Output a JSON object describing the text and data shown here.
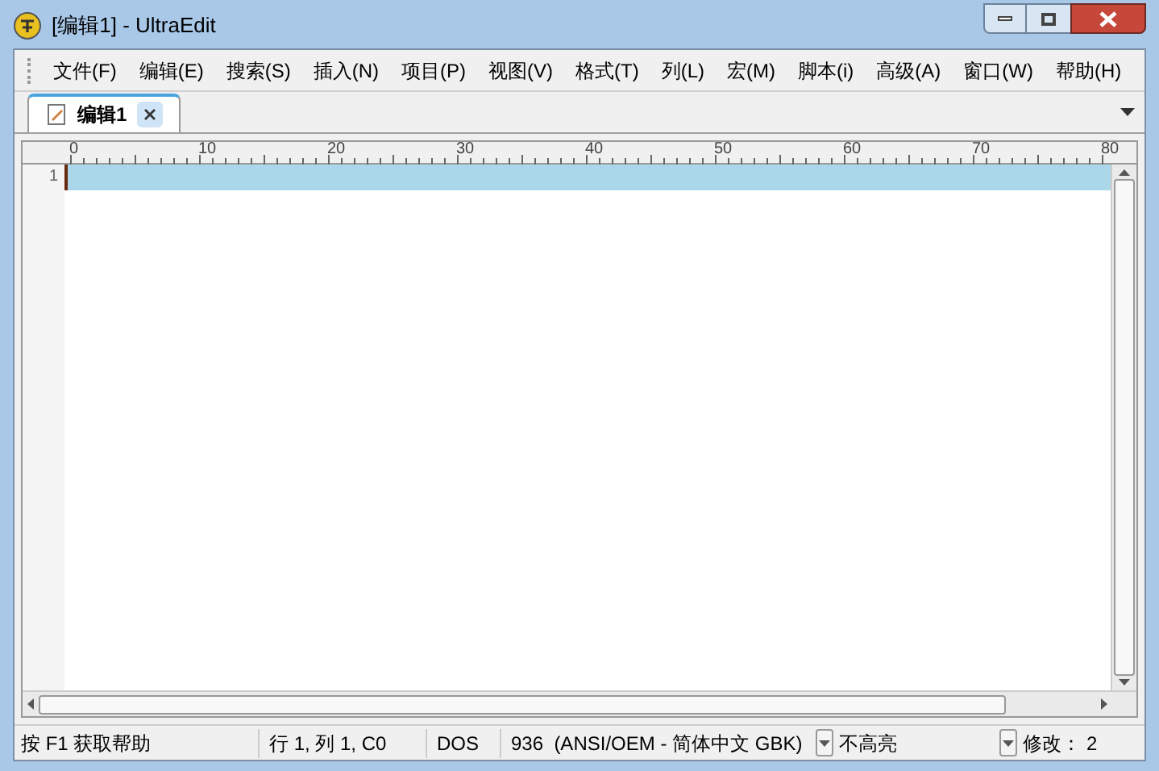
{
  "window": {
    "title": "[编辑1] - UltraEdit"
  },
  "menu": [
    "文件(F)",
    "编辑(E)",
    "搜索(S)",
    "插入(N)",
    "项目(P)",
    "视图(V)",
    "格式(T)",
    "列(L)",
    "宏(M)",
    "脚本(i)",
    "高级(A)",
    "窗口(W)",
    "帮助(H)"
  ],
  "tabs": [
    {
      "label": "编辑1",
      "selected": true
    }
  ],
  "ruler": [
    "0",
    "10",
    "20",
    "30",
    "40",
    "50",
    "60",
    "70",
    "80"
  ],
  "editor": {
    "line_numbers": [
      "1"
    ]
  },
  "status_bar": {
    "help": "按 F1 获取帮助",
    "position": "行 1, 列 1, C0",
    "line_ending": "DOS",
    "encoding": "936  (ANSI/OEM - 简体中文 GBK)",
    "highlight": "不高亮",
    "modified": "修改： 2"
  }
}
